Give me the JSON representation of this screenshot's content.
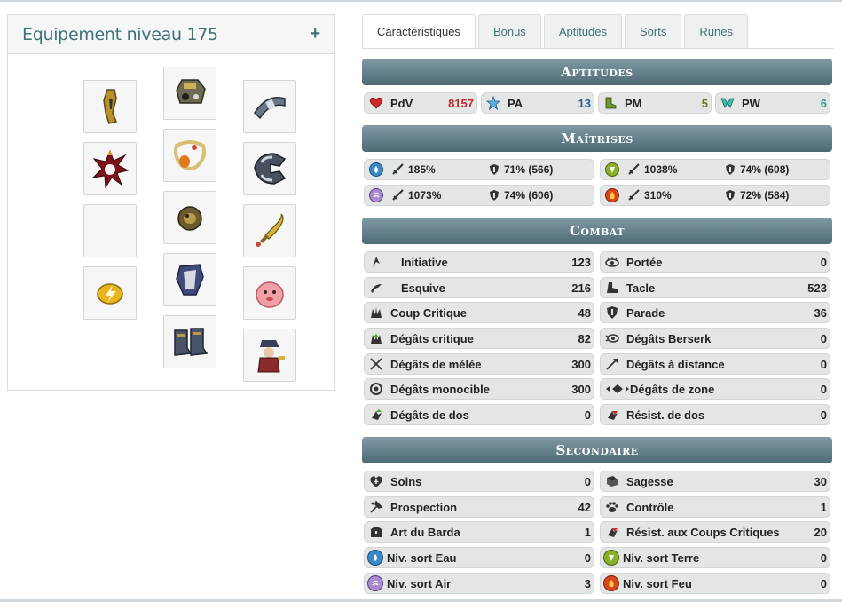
{
  "equipment": {
    "title": "Equipement niveau 175",
    "plus": "+"
  },
  "tabs": [
    "Caractéristiques",
    "Bonus",
    "Aptitudes",
    "Sorts",
    "Runes"
  ],
  "sections": {
    "aptitudes": "Aptitudes",
    "maitrises": "Maîtrises",
    "combat": "Combat",
    "secondaire": "Secondaire"
  },
  "aptitudes": [
    {
      "label": "PdV",
      "value": "8157",
      "color": "#c0262d"
    },
    {
      "label": "PA",
      "value": "13",
      "color": "#2a5d8f"
    },
    {
      "label": "PM",
      "value": "5",
      "color": "#6b7a1f"
    },
    {
      "label": "PW",
      "value": "6",
      "color": "#2a9a86"
    }
  ],
  "maitrises": [
    {
      "element": "water",
      "mastery": "185%",
      "resist": "71% (566)"
    },
    {
      "element": "earth",
      "mastery": "1038%",
      "resist": "74% (608)"
    },
    {
      "element": "air",
      "mastery": "1073%",
      "resist": "74% (606)"
    },
    {
      "element": "fire",
      "mastery": "310%",
      "resist": "72% (584)"
    }
  ],
  "combat_left": [
    {
      "label": "Initiative",
      "value": "123"
    },
    {
      "label": "Esquive",
      "value": "216"
    },
    {
      "label": "Coup Critique",
      "value": "48"
    },
    {
      "label": "Dégâts critique",
      "value": "82"
    },
    {
      "label": "Dégâts de mélée",
      "value": "300"
    },
    {
      "label": "Dégâts monocible",
      "value": "300"
    },
    {
      "label": "Dégâts de dos",
      "value": "0"
    }
  ],
  "combat_right": [
    {
      "label": "Portée",
      "value": "0"
    },
    {
      "label": "Tacle",
      "value": "523"
    },
    {
      "label": "Parade",
      "value": "36"
    },
    {
      "label": "Dégâts Berserk",
      "value": "0"
    },
    {
      "label": "Dégâts à distance",
      "value": "0"
    },
    {
      "label": "Dégâts de zone",
      "value": "0"
    },
    {
      "label": "Résist. de dos",
      "value": "0"
    }
  ],
  "secondaire_left": [
    {
      "label": "Soins",
      "value": "0"
    },
    {
      "label": "Prospection",
      "value": "42"
    },
    {
      "label": "Art du Barda",
      "value": "1"
    },
    {
      "label": "Niv. sort Eau",
      "value": "0"
    },
    {
      "label": "Niv. sort Air",
      "value": "3"
    }
  ],
  "secondaire_right": [
    {
      "label": "Sagesse",
      "value": "30"
    },
    {
      "label": "Contrôle",
      "value": "1"
    },
    {
      "label": "Résist. aux Coups Critiques",
      "value": "20"
    },
    {
      "label": "Niv. sort Terre",
      "value": "0"
    },
    {
      "label": "Niv. sort Feu",
      "value": "0"
    }
  ]
}
